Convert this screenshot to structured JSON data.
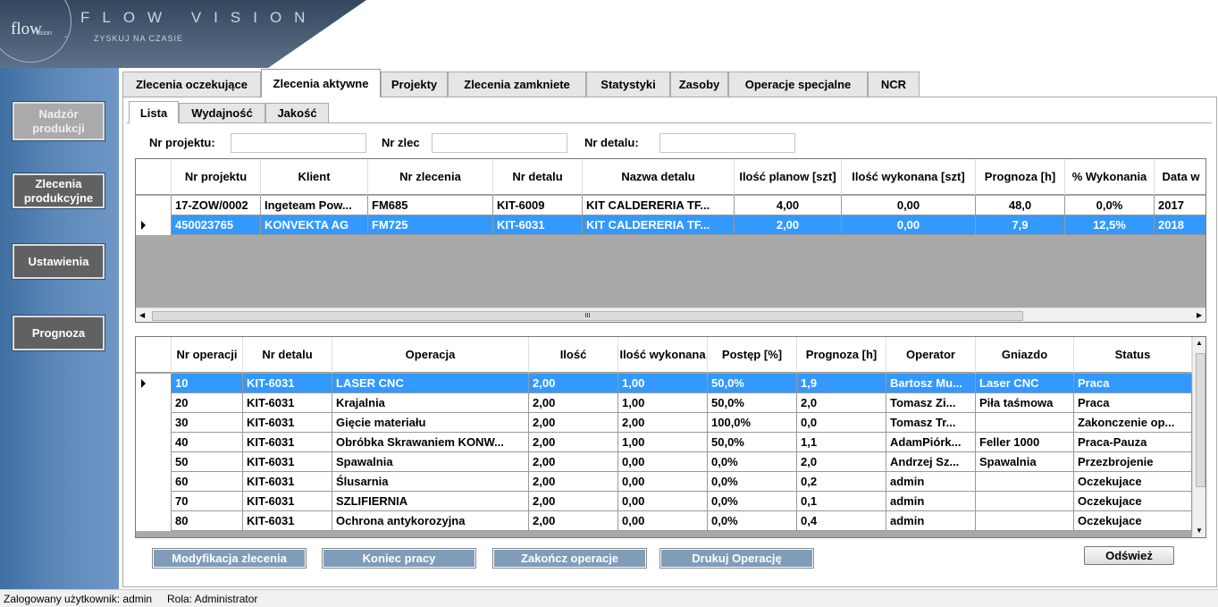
{
  "branding": {
    "logo_text": "flow",
    "logo_sub": "vision",
    "logo_dash": "-",
    "name": "FLOW VISION",
    "slogan": "ZYSKUJ NA CZASIE"
  },
  "sidebar": {
    "items": [
      {
        "label": "Nadzór produkcji",
        "enabled": false
      },
      {
        "label": "Zlecenia produkcyjne",
        "enabled": true
      },
      {
        "label": "Ustawienia",
        "enabled": true
      },
      {
        "label": "Prognoza",
        "enabled": true
      }
    ]
  },
  "tabs": [
    {
      "label": "Zlecenia oczekujące"
    },
    {
      "label": "Zlecenia aktywne",
      "active": true
    },
    {
      "label": "Projekty"
    },
    {
      "label": "Zlecenia zamkniete"
    },
    {
      "label": "Statystyki"
    },
    {
      "label": "Zasoby"
    },
    {
      "label": "Operacje specjalne"
    },
    {
      "label": "NCR"
    }
  ],
  "subtabs": [
    {
      "label": "Lista",
      "active": true
    },
    {
      "label": "Wydajność"
    },
    {
      "label": "Jakość"
    }
  ],
  "filters": {
    "project_label": "Nr projektu:",
    "project_value": "",
    "order_label": "Nr zlec",
    "order_value": "",
    "detail_label": "Nr detalu:",
    "detail_value": ""
  },
  "orders": {
    "columns": [
      "Nr projektu",
      "Klient",
      "Nr zlecenia",
      "Nr detalu",
      "Nazwa detalu",
      "Ilość planow [szt]",
      "Ilość wykonana [szt]",
      "Prognoza [h]",
      "% Wykonania",
      "Data w"
    ],
    "rows": [
      {
        "cells": [
          "17-ZOW/0002",
          "Ingeteam Pow...",
          "FM685",
          "KIT-6009",
          "KIT CALDERERIA TF...",
          "4,00",
          "0,00",
          "48,0",
          "0,0%",
          "2017"
        ],
        "selected": false
      },
      {
        "cells": [
          "450023765",
          "KONVEKTA AG",
          "FM725",
          "KIT-6031",
          "KIT CALDERERIA TF...",
          "2,00",
          "0,00",
          "7,9",
          "12,5%",
          "2018"
        ],
        "selected": true
      }
    ],
    "scroll_thumb_label": "III"
  },
  "operations": {
    "columns": [
      "Nr operacji",
      "Nr detalu",
      "Operacja",
      "Ilość",
      "Ilość wykonana",
      "Postęp [%]",
      "Prognoza [h]",
      "Operator",
      "Gniazdo",
      "Status"
    ],
    "rows": [
      {
        "cells": [
          "10",
          "KIT-6031",
          "LASER CNC",
          "2,00",
          "1,00",
          "50,0%",
          "1,9",
          "Bartosz Mu...",
          "Laser CNC",
          "Praca"
        ],
        "selected": true
      },
      {
        "cells": [
          "20",
          "KIT-6031",
          "Krajalnia",
          "2,00",
          "1,00",
          "50,0%",
          "2,0",
          "Tomasz Zi...",
          "Piła taśmowa",
          "Praca"
        ],
        "selected": false
      },
      {
        "cells": [
          "30",
          "KIT-6031",
          "Gięcie materiału",
          "2,00",
          "2,00",
          "100,0%",
          "0,0",
          "Tomasz Tr...",
          "",
          "Zakonczenie op..."
        ],
        "selected": false
      },
      {
        "cells": [
          "40",
          "KIT-6031",
          "Obróbka Skrawaniem KONW...",
          "2,00",
          "1,00",
          "50,0%",
          "1,1",
          "AdamPiórk...",
          "Feller 1000",
          "Praca-Pauza"
        ],
        "selected": false
      },
      {
        "cells": [
          "50",
          "KIT-6031",
          "Spawalnia",
          "2,00",
          "0,00",
          "0,0%",
          "2,0",
          "Andrzej Sz...",
          "Spawalnia",
          "Przezbrojenie"
        ],
        "selected": false
      },
      {
        "cells": [
          "60",
          "KIT-6031",
          "Ślusarnia",
          "2,00",
          "0,00",
          "0,0%",
          "0,2",
          "admin",
          "",
          "Oczekujace"
        ],
        "selected": false
      },
      {
        "cells": [
          "70",
          "KIT-6031",
          "SZLIFIERNIA",
          "2,00",
          "0,00",
          "0,0%",
          "0,1",
          "admin",
          "",
          "Oczekujace"
        ],
        "selected": false
      },
      {
        "cells": [
          "80",
          "KIT-6031",
          "Ochrona antykorozyjna",
          "2,00",
          "0,00",
          "0,0%",
          "0,4",
          "admin",
          "",
          "Oczekujace"
        ],
        "selected": false
      }
    ]
  },
  "actions": {
    "modify": "Modyfikacja zlecenia",
    "end_work": "Koniec pracy",
    "finish_op": "Zakończ operacje",
    "print_op": "Drukuj Operację",
    "refresh": "Odśwież"
  },
  "status": {
    "user": "Zalogowany użytkownik: admin",
    "role": "Rola: Administrator"
  }
}
